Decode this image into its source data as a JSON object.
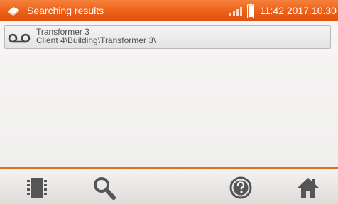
{
  "statusbar": {
    "title": "Searching results",
    "time": "11:42 2017.10.30",
    "app_icon": "meter-icon",
    "signal_icon": "signal-strength-icon",
    "battery_icon": "battery-icon"
  },
  "results": [
    {
      "name": "Transformer 3",
      "path": "Client 4\\Building\\Transformer 3\\",
      "icon": "measurement-record-icon"
    }
  ],
  "toolbar": {
    "buttons": [
      "memory-icon",
      "search-icon",
      "help-icon",
      "home-icon"
    ]
  },
  "colors": {
    "accent": "#ec5f17",
    "icon": "#555555"
  }
}
